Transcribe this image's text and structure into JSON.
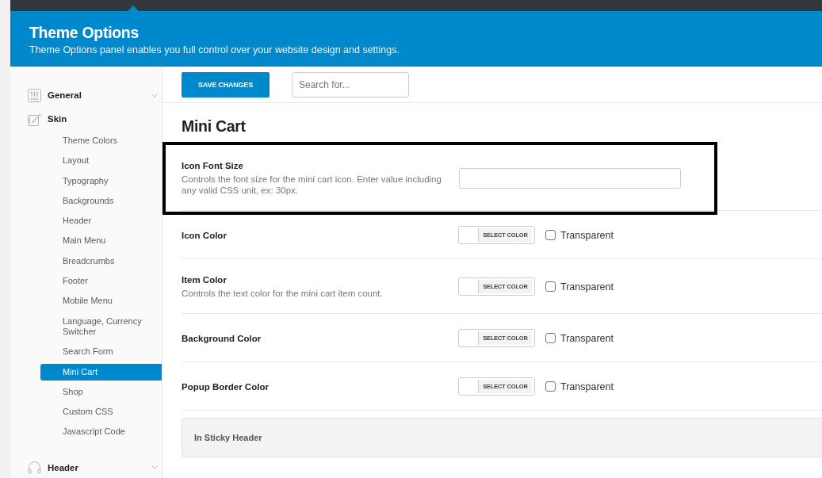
{
  "header": {
    "title": "Theme Options",
    "subtitle": "Theme Options panel enables you full control over your website design and settings."
  },
  "sidebar": {
    "groups": [
      {
        "label": "General",
        "expanded": false
      },
      {
        "label": "Skin",
        "expanded": true,
        "children": [
          {
            "label": "Theme Colors",
            "selected": false
          },
          {
            "label": "Layout",
            "selected": false
          },
          {
            "label": "Typography",
            "selected": false
          },
          {
            "label": "Backgrounds",
            "selected": false
          },
          {
            "label": "Header",
            "selected": false
          },
          {
            "label": "Main Menu",
            "selected": false
          },
          {
            "label": "Breadcrumbs",
            "selected": false
          },
          {
            "label": "Footer",
            "selected": false
          },
          {
            "label": "Mobile Menu",
            "selected": false
          },
          {
            "label": "Language, Currency Switcher",
            "selected": false
          },
          {
            "label": "Search Form",
            "selected": false
          },
          {
            "label": "Mini Cart",
            "selected": true
          },
          {
            "label": "Shop",
            "selected": false
          },
          {
            "label": "Custom CSS",
            "selected": false
          },
          {
            "label": "Javascript Code",
            "selected": false
          }
        ]
      },
      {
        "label": "Header",
        "expanded": false
      }
    ]
  },
  "toolbar": {
    "save_button": "SAVE CHANGES",
    "search": {
      "placeholder": "Search for..."
    }
  },
  "section": {
    "title": "Mini Cart",
    "options": [
      {
        "kind": "text",
        "label": "Icon Font Size",
        "description": "Controls the font size for the mini cart icon. Enter value including any valid CSS unit, ex: 30px.",
        "highlighted": true
      },
      {
        "kind": "color",
        "label": "Icon Color",
        "button": "SELECT COLOR",
        "transparent": {
          "label": "Transparent",
          "checked": false
        },
        "highlighted": false
      },
      {
        "kind": "color",
        "label": "Item Color",
        "description": "Controls the text color for the mini cart item count.",
        "button": "SELECT COLOR",
        "transparent": {
          "label": "Transparent",
          "checked": false
        },
        "highlighted": false
      },
      {
        "kind": "color",
        "label": "Background Color",
        "button": "SELECT COLOR",
        "transparent": {
          "label": "Transparent",
          "checked": false
        },
        "highlighted": false
      },
      {
        "kind": "color",
        "label": "Popup Border Color",
        "button": "SELECT COLOR",
        "transparent": {
          "label": "Transparent",
          "checked": false
        },
        "highlighted": false
      }
    ],
    "subsection": {
      "title": "In Sticky Header"
    }
  }
}
